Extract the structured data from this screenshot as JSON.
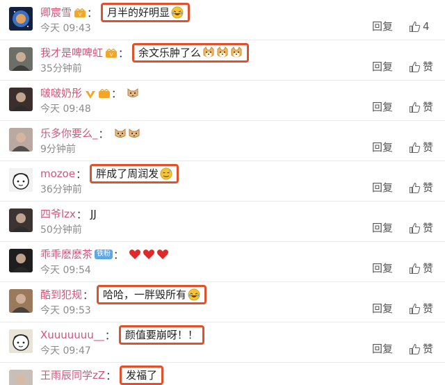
{
  "rows": [
    {
      "name": "卿宸雪",
      "badge": "vip",
      "comment": "月半的好明显",
      "emoji": [
        "laugh-cry"
      ],
      "boxed": true,
      "time": "今天 09:43",
      "reply": "回复",
      "like": "4",
      "avatar_color": "#2c4a7a",
      "avatar_icon": "galaxy-icon"
    },
    {
      "name": "我才是啤啤虹",
      "badge": "vip",
      "comment": "余文乐肿了么",
      "emoji": [
        "shiba",
        "shiba",
        "shiba"
      ],
      "boxed": true,
      "time": "35分钟前",
      "reply": "回复",
      "like": "赞",
      "avatar_color": "#6b6f68",
      "avatar_icon": "person-photo-icon"
    },
    {
      "name": "啵啵奶彤",
      "badge": "v-vip",
      "comment": "",
      "emoji": [
        "cat"
      ],
      "boxed": false,
      "time": "今天 09:48",
      "reply": "回复",
      "like": "赞",
      "avatar_color": "#3a2f2c",
      "avatar_icon": "person-photo-icon"
    },
    {
      "name": "乐多你要么_",
      "badge": "",
      "comment": "",
      "emoji": [
        "cat",
        "cat"
      ],
      "boxed": false,
      "colon": "：",
      "time": "9分钟前",
      "reply": "回复",
      "like": "赞",
      "avatar_color": "#b9a9a0",
      "avatar_icon": "person-photo-icon"
    },
    {
      "name": "mozoe",
      "badge": "",
      "comment": "胖成了周润发",
      "emoji": [
        "sweat"
      ],
      "boxed": true,
      "colon": "：",
      "time": "36分钟前",
      "reply": "回复",
      "like": "赞",
      "avatar_color": "#f2f2f2",
      "avatar_icon": "cartoon-face-icon"
    },
    {
      "name": "四爷lzx",
      "badge": "",
      "comment": "JJ",
      "emoji": [],
      "boxed": false,
      "colon": "：",
      "time": "50分钟前",
      "reply": "回复",
      "like": "赞",
      "avatar_color": "#3b3432",
      "avatar_icon": "person-photo-icon"
    },
    {
      "name": "乖乖麽麽茶",
      "badge": "fan",
      "badge_text": "铁粉",
      "comment": "",
      "emoji": [
        "heart",
        "heart",
        "heart"
      ],
      "boxed": false,
      "colon": "：",
      "time": "今天 09:54",
      "reply": "回复",
      "like": "赞",
      "avatar_color": "#1e1e1e",
      "avatar_icon": "person-photo-icon"
    },
    {
      "name": "酷到犯规",
      "badge": "",
      "comment": "哈哈，一胖毁所有",
      "emoji": [
        "laugh-cry"
      ],
      "boxed": true,
      "colon": "：",
      "time": "今天 09:53",
      "reply": "回复",
      "like": "赞",
      "avatar_color": "#9b7a5c",
      "avatar_icon": "person-photo-icon"
    },
    {
      "name": "Xuuuuuuu__",
      "badge": "",
      "comment": "颜值要崩呀！！",
      "emoji": [],
      "boxed": true,
      "colon": "：",
      "time": "今天 09:47",
      "reply": "回复",
      "like": "赞",
      "avatar_color": "#e8e4d8",
      "avatar_icon": "cartoon-face-icon"
    },
    {
      "name": "王雨辰同学zZ",
      "badge": "",
      "comment": "发福了",
      "emoji": [],
      "boxed": true,
      "colon": "：",
      "time": "",
      "reply": "",
      "like": "",
      "avatar_color": "#c8c0b8",
      "avatar_icon": "person-photo-icon"
    }
  ],
  "colors": {
    "name": "#d4547a",
    "box": "#e0502a",
    "time": "#8c8c8c"
  }
}
